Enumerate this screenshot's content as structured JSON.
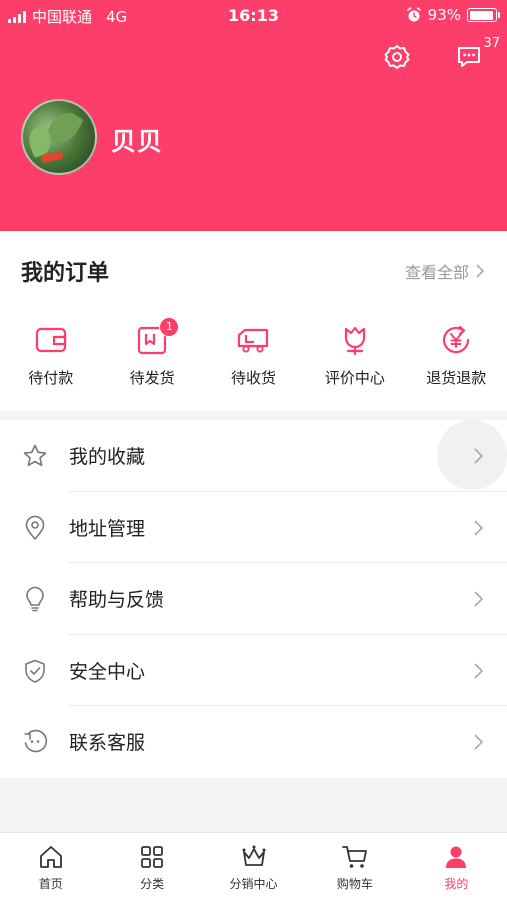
{
  "status_bar": {
    "carrier": "中国联通",
    "network": "4G",
    "time": "16:13",
    "battery": "93%",
    "battery_level": 0.93
  },
  "header": {
    "username": "贝贝",
    "message_count": "37",
    "settings_icon": "gear-icon",
    "message_icon": "chat-bubble-icon",
    "background_color": "#fd3e6b"
  },
  "orders": {
    "title": "我的订单",
    "view_all": "查看全部",
    "items": [
      {
        "label": "待付款",
        "icon": "wallet-icon"
      },
      {
        "label": "待发货",
        "icon": "package-icon",
        "badge": "1"
      },
      {
        "label": "待收货",
        "icon": "truck-icon"
      },
      {
        "label": "评价中心",
        "icon": "tulip-icon"
      },
      {
        "label": "退货退款",
        "icon": "yen-refund-icon"
      }
    ]
  },
  "menu": {
    "items": [
      {
        "label": "我的收藏",
        "icon": "star-icon"
      },
      {
        "label": "地址管理",
        "icon": "location-pin-icon"
      },
      {
        "label": "帮助与反馈",
        "icon": "lightbulb-icon"
      },
      {
        "label": "安全中心",
        "icon": "shield-icon"
      },
      {
        "label": "联系客服",
        "icon": "customer-service-icon"
      }
    ]
  },
  "tabbar": {
    "items": [
      {
        "label": "首页",
        "icon": "home-icon"
      },
      {
        "label": "分类",
        "icon": "grid-icon"
      },
      {
        "label": "分销中心",
        "icon": "crown-icon"
      },
      {
        "label": "购物车",
        "icon": "cart-icon"
      },
      {
        "label": "我的",
        "icon": "user-icon",
        "active": true
      }
    ],
    "accent_color": "#fd3e6b"
  }
}
